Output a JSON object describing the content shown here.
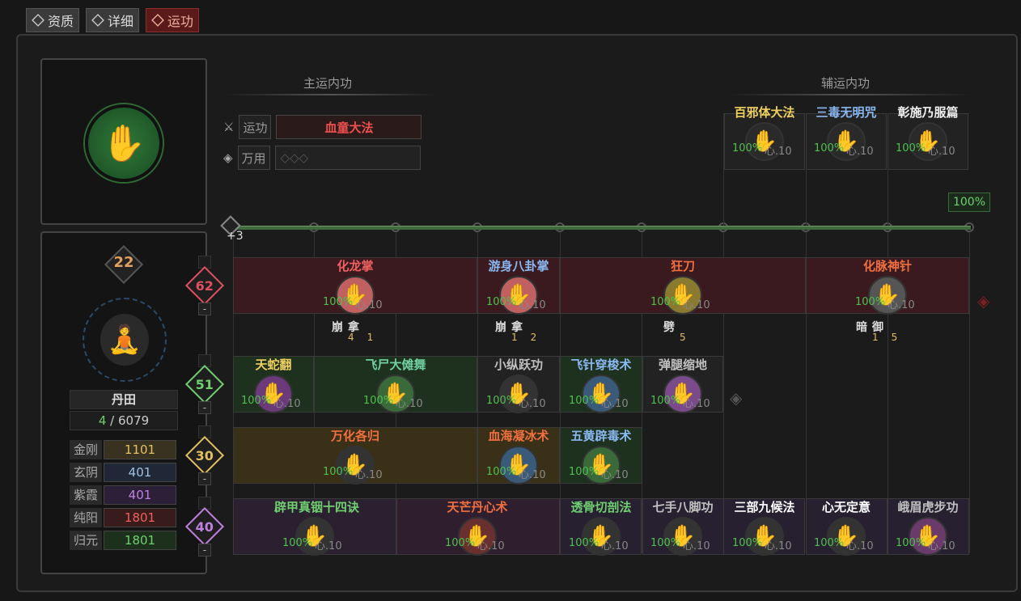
{
  "tabs": [
    {
      "label": "资质"
    },
    {
      "label": "详细"
    },
    {
      "label": "运功"
    }
  ],
  "main": {
    "title": "主运内功",
    "run_label": "运功",
    "run_value": "血童大法",
    "wanyong_label": "万用"
  },
  "aux": {
    "title": "辅运内功",
    "percent": "100%",
    "items": [
      {
        "name": "百邪体大法",
        "pct": "100%",
        "xin": "心.10",
        "color": "#f0d060"
      },
      {
        "name": "三毒无明咒",
        "pct": "100%",
        "xin": "心.10",
        "color": "#8ab8f0"
      },
      {
        "name": "彰施乃服篇",
        "pct": "100%",
        "xin": "心.10",
        "color": "#f0f0f0"
      }
    ]
  },
  "track_plus": "+3",
  "char": {
    "level": "22",
    "dantian_label": "丹田",
    "dantian_current": "4",
    "dantian_sep": "/",
    "dantian_max": "6079",
    "attrs": [
      {
        "k": "金刚",
        "v": "1101",
        "color": "#e0c060",
        "bg": "#3a3220"
      },
      {
        "k": "玄阴",
        "v": "401",
        "color": "#a0c0e0",
        "bg": "#202838"
      },
      {
        "k": "紫霞",
        "v": "401",
        "color": "#c080e0",
        "bg": "#2c2038"
      },
      {
        "k": "纯阳",
        "v": "1801",
        "color": "#f06060",
        "bg": "#381c1c"
      },
      {
        "k": "归元",
        "v": "1801",
        "color": "#70d070",
        "bg": "#1c301c"
      }
    ]
  },
  "tiers": [
    {
      "value": "62",
      "color": "#e05060"
    },
    {
      "value": "51",
      "color": "#70d070"
    },
    {
      "value": "30",
      "color": "#e0c060"
    },
    {
      "value": "40",
      "color": "#c080e0"
    }
  ],
  "minus": "-",
  "row1": [
    {
      "name": "化龙掌",
      "color": "#f06060",
      "pct": "100%",
      "xin": "心.10"
    },
    {
      "name": "游身八卦掌",
      "color": "#8ab8f0",
      "pct": "100%",
      "xin": "心.10"
    },
    {
      "name": "狂刀",
      "color": "#f07040",
      "pct": "100%",
      "xin": "心.10"
    },
    {
      "name": "化脉神针",
      "color": "#f07040",
      "pct": "100%",
      "xin": "心.10"
    }
  ],
  "hints": [
    {
      "a": "崩",
      "b": "拿",
      "n1": "4",
      "n2": "1"
    },
    {
      "a": "崩",
      "b": "拿",
      "n1": "1",
      "n2": "2"
    },
    {
      "a": "劈",
      "n1": "5"
    },
    {
      "a": "暗",
      "b": "御",
      "n1": "1",
      "n2": "5"
    }
  ],
  "row2": [
    {
      "name": "天蛇翻",
      "color": "#f0d060",
      "pct": "100%",
      "xin": "心.10"
    },
    {
      "name": "飞尸大傩舞",
      "color": "#70d0a0",
      "pct": "100%",
      "xin": "心.10"
    },
    {
      "name": "小纵跃功",
      "color": "#c0c0c0",
      "pct": "100%",
      "xin": "心.10"
    },
    {
      "name": "飞针穿梭术",
      "color": "#8ab8f0",
      "pct": "100%",
      "xin": "心.10"
    },
    {
      "name": "弹腿缩地",
      "color": "#c0c0c0",
      "pct": "100%",
      "xin": "心.10"
    }
  ],
  "row3": [
    {
      "name": "万化各归",
      "color": "#f07040",
      "pct": "100%",
      "xin": "心.10"
    },
    {
      "name": "血海凝冰术",
      "color": "#f07040",
      "pct": "100%",
      "xin": "心.10"
    },
    {
      "name": "五黄辟毒术",
      "color": "#8ab8f0",
      "pct": "100%",
      "xin": "心.10"
    }
  ],
  "row4": [
    {
      "name": "辟甲真铟十四诀",
      "color": "#70d070",
      "pct": "100%",
      "xin": "心.10"
    },
    {
      "name": "天芒丹心术",
      "color": "#f07040",
      "pct": "100%",
      "xin": "心.10"
    },
    {
      "name": "透骨切剖法",
      "color": "#70d070",
      "pct": "100%",
      "xin": "心.10"
    },
    {
      "name": "七手八脚功",
      "color": "#c0c0c0",
      "pct": "100%",
      "xin": "心.10"
    },
    {
      "name": "三部九候法",
      "color": "#ffffff",
      "pct": "100%",
      "xin": "心.10"
    },
    {
      "name": "心无定意",
      "color": "#ffffff",
      "pct": "100%",
      "xin": "心.10"
    },
    {
      "name": "峨眉虎步功",
      "color": "#c0c0c0",
      "pct": "100%",
      "xin": "心.10"
    }
  ]
}
